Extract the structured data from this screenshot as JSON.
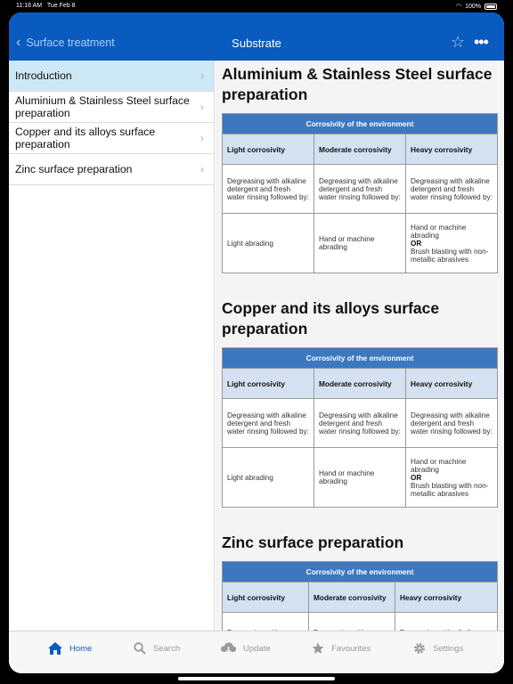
{
  "status_bar": {
    "time": "11:16 AM",
    "date": "Tue Feb 8",
    "battery": "100%"
  },
  "nav": {
    "back_label": "Surface treatment",
    "title": "Substrate"
  },
  "sidebar": {
    "items": [
      {
        "label": "Introduction",
        "active": true
      },
      {
        "label": "Aluminium & Stainless Steel surface preparation"
      },
      {
        "label": "Copper and its alloys surface preparation"
      },
      {
        "label": "Zinc surface preparation"
      }
    ]
  },
  "sections": [
    {
      "title": "Aluminium & Stainless Steel surface preparation",
      "caption": "Corrosivity of the environment",
      "headers": [
        "Light corrosivity",
        "Moderate corrosivity",
        "Heavy corrosivity"
      ],
      "row1": [
        "Degreasing with alkaline detergent and fresh water rinsing followed by:",
        "Degreasing with alkaline detergent and fresh water rinsing followed by:",
        "Degreasing with alkaline detergent and fresh water rinsing followed by:"
      ],
      "row2": [
        "Light abrading",
        "Hand or machine abrading",
        "Hand or machine abrading",
        "OR",
        "Brush blasting with non-metallic abrasives"
      ]
    },
    {
      "title": "Copper and its alloys surface preparation",
      "caption": "Corrosivity of the environment",
      "headers": [
        "Light corrosivity",
        "Moderate corrosivity",
        "Heavy corrosivity"
      ],
      "row1": [
        "Degreasing with alkaline detergent and fresh water rinsing followed by:",
        "Degreasing with alkaline detergent and fresh water rinsing followed by:",
        "Degreasing with alkaline detergent and fresh water rinsing followed by:"
      ],
      "row2": [
        "Light abrading",
        "Hand or machine abrading",
        "Hand or machine abrading",
        "OR",
        "Brush blasting with non-metallic abrasives"
      ]
    },
    {
      "title": "Zinc surface preparation",
      "caption": "Corrosivity of the environment",
      "headers": [
        "Light corrosivity",
        "Moderate corrosivity",
        "Heavy corrosivity"
      ],
      "row1": [
        "Degreasing with alkaline detergent",
        "Degreasing with alkaline detergent",
        "Degreasing with alkaline detergent and fresh"
      ]
    }
  ],
  "tabs": [
    {
      "label": "Home",
      "icon": "home-icon",
      "active": true
    },
    {
      "label": "Search",
      "icon": "search-icon"
    },
    {
      "label": "Update",
      "icon": "cloud-download-icon"
    },
    {
      "label": "Favourites",
      "icon": "star-icon"
    },
    {
      "label": "Settings",
      "icon": "gear-icon"
    }
  ],
  "colors": {
    "nav_blue": "#0a5bbf",
    "table_caption": "#3b78c0",
    "table_header": "#d3e1f1",
    "active_row": "#cde8f7"
  }
}
